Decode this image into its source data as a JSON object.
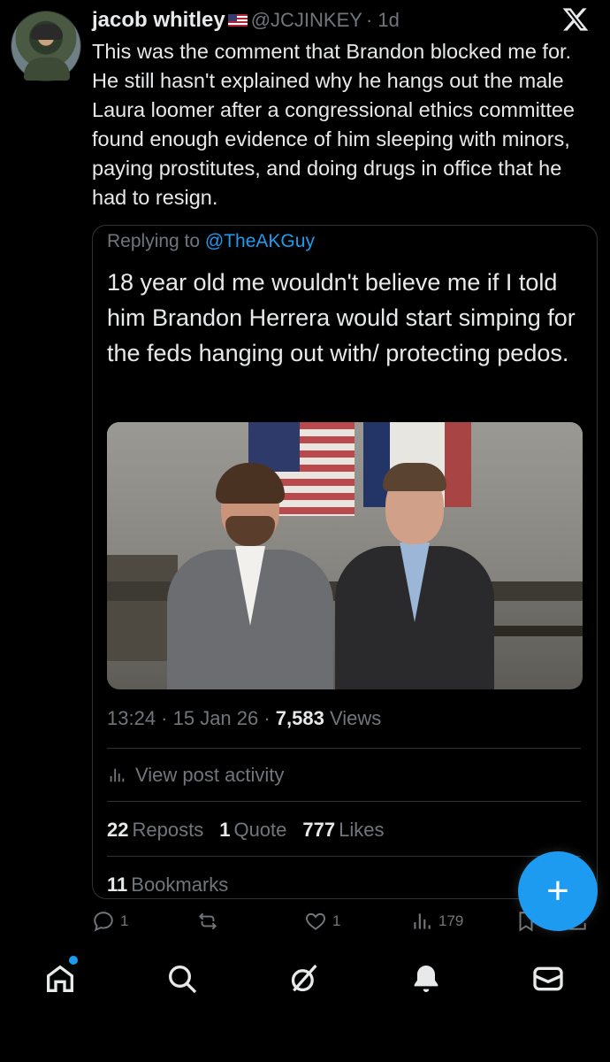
{
  "tweet": {
    "display_name": "jacob whitley",
    "handle": "@JCJINKEY",
    "time_ago": "· 1d",
    "text": "This was the comment that Brandon blocked me for. He still hasn't explained why he hangs out the male Laura loomer after a congressional ethics committee found enough evidence of him sleeping with minors, paying prostitutes, and doing drugs in office that he had to resign."
  },
  "quote": {
    "replying_prefix": "Replying to ",
    "replying_mention": "@TheAKGuy",
    "text": "18 year old me wouldn't believe me if I told him Brandon Herrera would start simping for the feds hanging out with/ protecting pedos.",
    "meta_time": "13:24 · 15 Jan 26 · ",
    "views_count": "7,583",
    "views_label": " Views",
    "activity_label": "View post activity",
    "reposts_count": "22",
    "reposts_label": "Reposts",
    "quote_count": "1",
    "quote_label": "Quote",
    "likes_count": "777",
    "likes_label": "Likes",
    "bookmarks_count": "11",
    "bookmarks_label": "Bookmarks"
  },
  "actions": {
    "replies": "1",
    "likes": "1",
    "views": "179"
  },
  "colors": {
    "background": "#000000",
    "text_primary": "#e7e9ea",
    "text_secondary": "#71767b",
    "accent": "#1d9bf0",
    "border": "#2f3336"
  },
  "icons": [
    "x-logo-icon",
    "reply-icon",
    "repost-icon",
    "like-icon",
    "views-icon",
    "bookmark-icon",
    "share-icon",
    "plus-icon",
    "home-icon",
    "search-icon",
    "grok-icon",
    "bell-icon",
    "mail-icon",
    "activity-icon"
  ]
}
